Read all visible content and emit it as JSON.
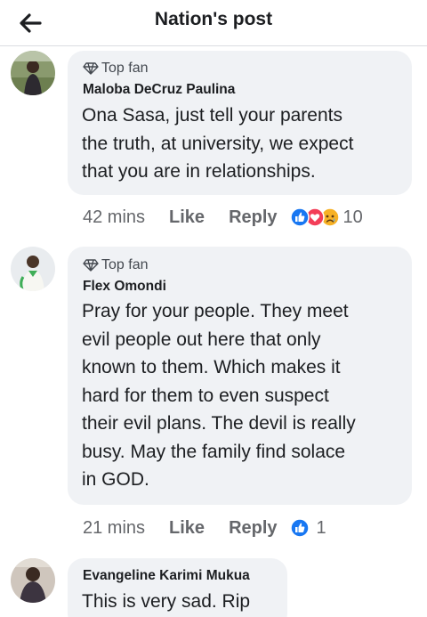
{
  "header": {
    "title": "Nation's post",
    "back_icon": "arrow-left-icon"
  },
  "comments": [
    {
      "badge": "Top fan",
      "author": "Maloba DeCruz Paulina",
      "lines": [
        "Ona Sasa, just tell your parents",
        "the truth, at university, we expect",
        "that you are in relationships."
      ],
      "time": "42 mins",
      "like_label": "Like",
      "reply_label": "Reply",
      "reactions": [
        "like",
        "love",
        "sad"
      ],
      "reaction_count": "10"
    },
    {
      "badge": "Top fan",
      "author": "Flex Omondi",
      "lines": [
        "Pray for your people. They meet",
        "evil people out here that only",
        "known to them. Which makes it",
        "hard for them to even suspect",
        "their evil plans. The devil is really",
        "busy. May the family find solace",
        "in GOD."
      ],
      "time": "21 mins",
      "like_label": "Like",
      "reply_label": "Reply",
      "reactions": [
        "like"
      ],
      "reaction_count": "1"
    },
    {
      "author": "Evangeline Karimi Mukua",
      "lines": [
        "This is very sad. Rip"
      ]
    }
  ],
  "colors": {
    "like_blue": "#1877f2",
    "love_red": "#f33e58",
    "sad_yellow": "#f7b125",
    "bubble_bg": "#f0f2f5",
    "meta_gray": "#65676b"
  }
}
